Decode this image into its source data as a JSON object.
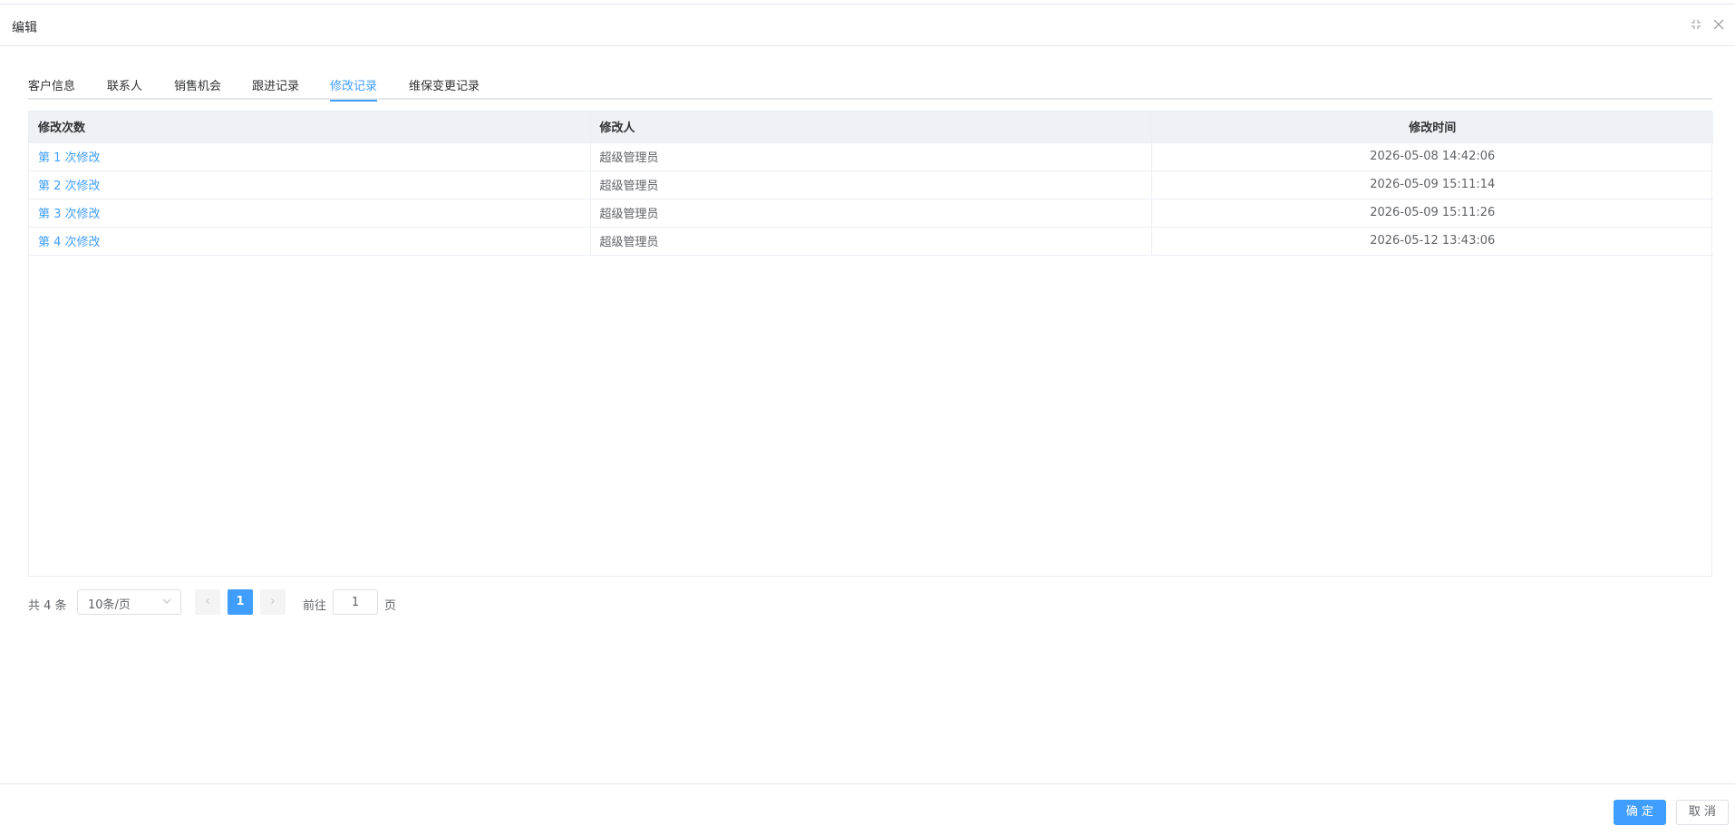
{
  "dialog": {
    "title": "编辑",
    "minimize_icon": "minimize-icon",
    "close_icon": "close-icon"
  },
  "tabs": [
    {
      "label": "客户信息",
      "active": false
    },
    {
      "label": "联系人",
      "active": false
    },
    {
      "label": "销售机会",
      "active": false
    },
    {
      "label": "跟进记录",
      "active": false
    },
    {
      "label": "修改记录",
      "active": true
    },
    {
      "label": "维保变更记录",
      "active": false
    }
  ],
  "table": {
    "headers": [
      "修改次数",
      "修改人",
      "修改时间"
    ],
    "rows": [
      {
        "count": "第 1 次修改",
        "user": "超级管理员",
        "time": "2026-05-08 14:42:06"
      },
      {
        "count": "第 2 次修改",
        "user": "超级管理员",
        "time": "2026-05-09 15:11:14"
      },
      {
        "count": "第 3 次修改",
        "user": "超级管理员",
        "time": "2026-05-09 15:11:26"
      },
      {
        "count": "第 4 次修改",
        "user": "超级管理员",
        "time": "2026-05-12 13:43:06"
      }
    ]
  },
  "pagination": {
    "total": "共 4 条",
    "page_size": "10条/页",
    "prev": "‹",
    "current_page": "1",
    "next": "›",
    "goto_label": "前往",
    "goto_value": "1",
    "goto_unit": "页"
  },
  "footer": {
    "confirm_label": "确 定",
    "cancel_label": "取 消"
  },
  "colors": {
    "accent": "#409eff",
    "header_bg": "#eef1f6"
  }
}
